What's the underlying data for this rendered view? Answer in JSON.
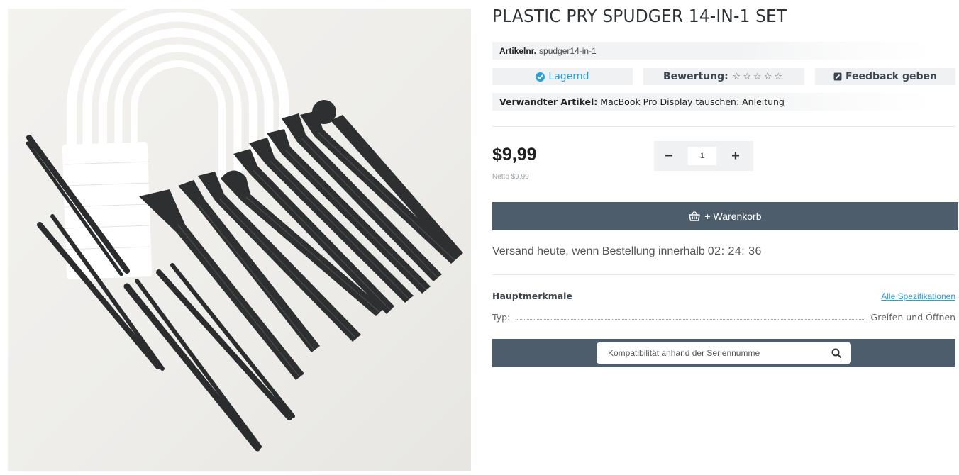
{
  "product": {
    "title": "PLASTIC PRY SPUDGER 14-IN-1 SET",
    "image_alt": "Product photo of black plastic spudger tools and tweezers"
  },
  "sku": {
    "label": "Artikelnr.",
    "value": "spudger14-in-1"
  },
  "stock": {
    "icon": "check-circle-icon",
    "label": "Lagernd"
  },
  "rating": {
    "label": "Bewertung:",
    "stars": "☆☆☆☆☆"
  },
  "feedback": {
    "icon": "edit-square-icon",
    "label": "Feedback geben"
  },
  "related": {
    "label": "Verwandter Artikel:",
    "link_text": "MacBook Pro Display tauschen: Anleitung"
  },
  "price": {
    "value": "$9,99",
    "netto": "Netto $9,99"
  },
  "quantity": {
    "minus": "−",
    "value": "1",
    "plus": "+"
  },
  "cart": {
    "icon": "basket-icon",
    "label": "+ Warenkorb"
  },
  "shipping": {
    "text": "Versand heute, wenn Bestellung innerhalb",
    "countdown": "02: 24: 36"
  },
  "features": {
    "title": "Hauptmerkmale",
    "all_specs_link": "Alle Spezifikationen",
    "rows": [
      {
        "label": "Typ:",
        "value": "Greifen und Öffnen"
      }
    ]
  },
  "serial_search": {
    "placeholder": "Kompatibilität anhand der Seriennumme",
    "icon": "search-icon"
  },
  "colors": {
    "accent": "#2f9fd8",
    "dark_button": "#4e5d6b",
    "pill_bg": "#eff1f3"
  }
}
